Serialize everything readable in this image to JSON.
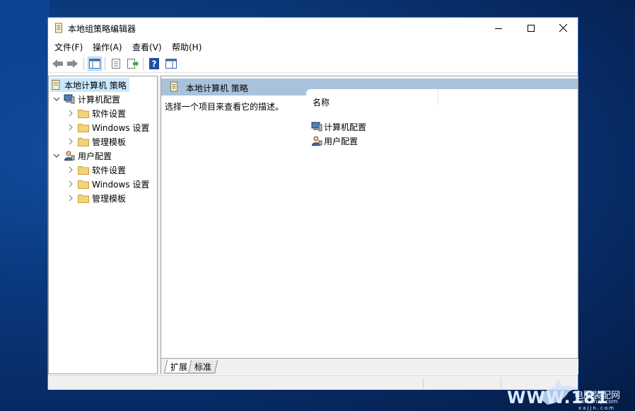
{
  "window": {
    "title": "本地组策略编辑器"
  },
  "menu": {
    "file": "文件(F)",
    "action": "操作(A)",
    "view": "查看(V)",
    "help": "帮助(H)"
  },
  "tree": {
    "root": "本地计算机 策略",
    "computer_config": "计算机配置",
    "computer_children": [
      "软件设置",
      "Windows 设置",
      "管理模板"
    ],
    "user_config": "用户配置",
    "user_children": [
      "软件设置",
      "Windows 设置",
      "管理模板"
    ]
  },
  "detail": {
    "header": "本地计算机 策略",
    "description": "选择一个项目来查看它的描述。",
    "column_name": "名称",
    "items": [
      "计算机配置",
      "用户配置"
    ]
  },
  "tabs": [
    "扩展",
    "标准"
  ],
  "watermark": {
    "main": "WWW.181",
    "sub1": "电脑装配网",
    "sub2": "www.dnzp.com",
    "sub3": "xajjn.com"
  },
  "colors": {
    "accent": "#3c7fd6",
    "header_bg": "#a9c2dc",
    "selection": "#cce8ff"
  }
}
